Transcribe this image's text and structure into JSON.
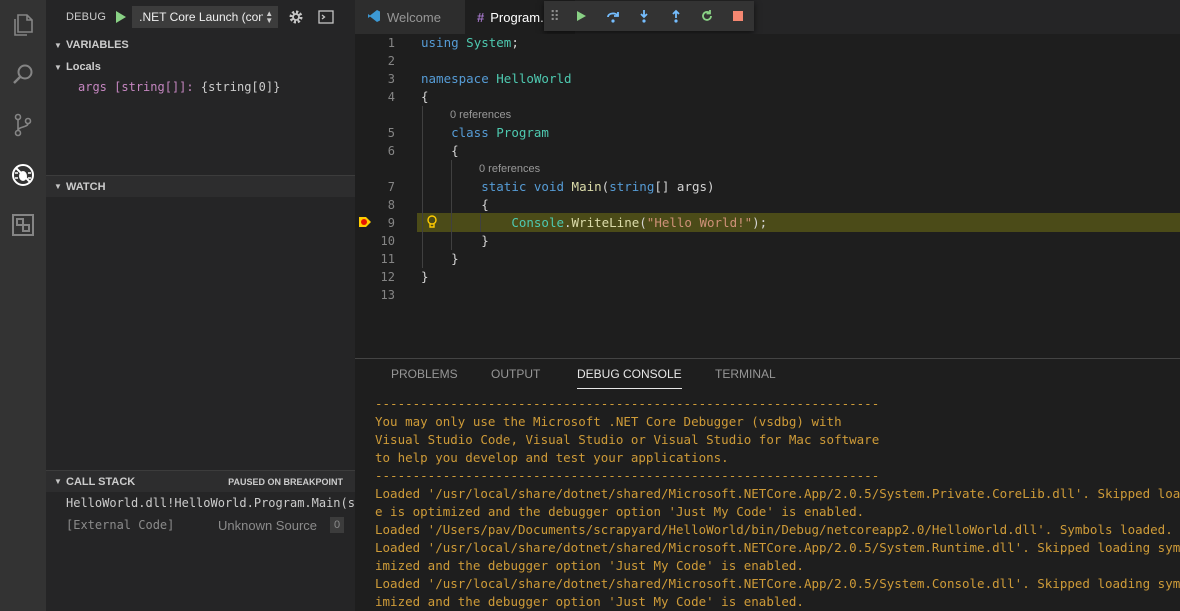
{
  "debug_toolbar": {
    "label": "DEBUG",
    "launch_config": ".NET Core Launch (console)"
  },
  "variables": {
    "title": "VARIABLES",
    "locals_label": "Locals",
    "args_name": "args",
    "args_type": "[string[]]:",
    "args_value": "{string[0]}"
  },
  "watch": {
    "title": "WATCH"
  },
  "call_stack": {
    "title": "CALL STACK",
    "status": "PAUSED ON BREAKPOINT",
    "frames": [
      {
        "name": "HelloWorld.dll!HelloWorld.Program.Main(string[] args)"
      },
      {
        "name": "[External Code]",
        "source": "Unknown Source",
        "line": "0"
      }
    ]
  },
  "tabs": [
    {
      "label": "Welcome"
    },
    {
      "label": "Program.cs"
    }
  ],
  "editor": {
    "line_numbers": [
      "1",
      "2",
      "3",
      "4",
      "5",
      "6",
      "7",
      "8",
      "9",
      "10",
      "11",
      "12",
      "13"
    ],
    "codelens": [
      "0 references",
      "0 references"
    ],
    "lines": {
      "l1_kw": "using",
      "l1_ns": "System",
      "l1_end": ";",
      "l3_kw": "namespace",
      "l3_name": "HelloWorld",
      "l4": "{",
      "l5_kw": "class",
      "l5_name": "Program",
      "l6": "{",
      "l7_kw1": "static",
      "l7_kw2": "void",
      "l7_fn": "Main",
      "l7_p1": "(",
      "l7_type": "string",
      "l7_rest": "[] args)",
      "l8": "{",
      "l9_cls": "Console",
      "l9_dot": ".",
      "l9_fn": "WriteLine",
      "l9_p1": "(",
      "l9_str": "\"Hello World!\"",
      "l9_end": ");",
      "l10": "}",
      "l11": "}",
      "l12": "}"
    }
  },
  "panel": {
    "tabs": [
      "PROBLEMS",
      "OUTPUT",
      "DEBUG CONSOLE",
      "TERMINAL"
    ],
    "active_tab": "DEBUG CONSOLE",
    "output": [
      "-------------------------------------------------------------------",
      "You may only use the Microsoft .NET Core Debugger (vsdbg) with",
      "Visual Studio Code, Visual Studio or Visual Studio for Mac software",
      "to help you develop and test your applications.",
      "-------------------------------------------------------------------",
      "Loaded '/usr/local/share/dotnet/shared/Microsoft.NETCore.App/2.0.5/System.Private.CoreLib.dll'. Skipped loading symbols. Module",
      "e is optimized and the debugger option 'Just My Code' is enabled.",
      "Loaded '/Users/pav/Documents/scrapyard/HelloWorld/bin/Debug/netcoreapp2.0/HelloWorld.dll'. Symbols loaded.",
      "Loaded '/usr/local/share/dotnet/shared/Microsoft.NETCore.App/2.0.5/System.Runtime.dll'. Skipped loading symbols. Module is opt",
      "imized and the debugger option 'Just My Code' is enabled.",
      "Loaded '/usr/local/share/dotnet/shared/Microsoft.NETCore.App/2.0.5/System.Console.dll'. Skipped loading symbols. Module is opt",
      "imized and the debugger option 'Just My Code' is enabled."
    ]
  },
  "colors": {
    "activity_bar": "#333333",
    "sidebar": "#252526",
    "editor": "#1e1e1e",
    "console_text": "#ce9b38",
    "highlight": "#4b4b18"
  }
}
